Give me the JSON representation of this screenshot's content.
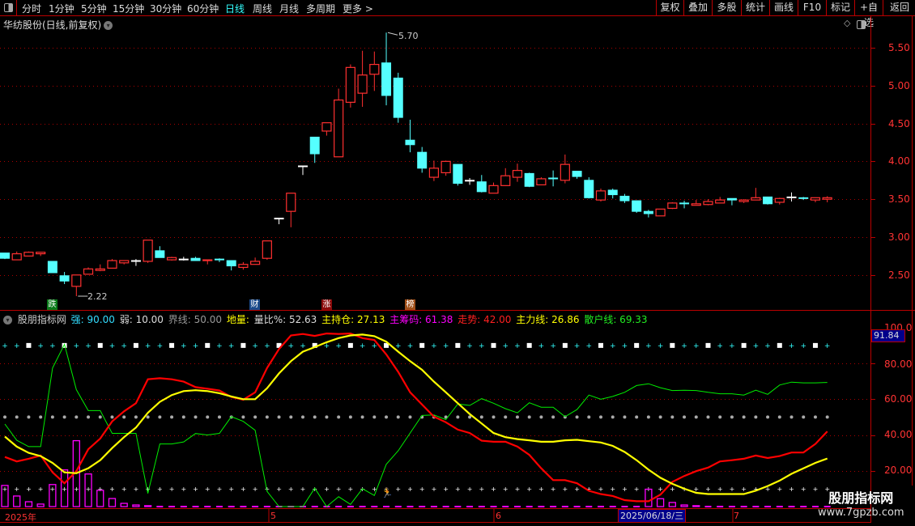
{
  "toolbar": {
    "periods": [
      "分时",
      "1分钟",
      "5分钟",
      "15分钟",
      "30分钟",
      "60分钟",
      "日线",
      "周线",
      "月线",
      "多周期",
      "更多 >"
    ],
    "active_period": "日线",
    "buttons": [
      "复权",
      "叠加",
      "多股",
      "统计",
      "画线",
      "F10",
      "标记",
      "+自选",
      "返回"
    ]
  },
  "stock": {
    "title": "华纺股份(日线,前复权)"
  },
  "price_axis": {
    "ticks": [
      "5.50",
      "5.00",
      "4.50",
      "4.00",
      "3.50",
      "3.00",
      "2.50"
    ]
  },
  "price_annotations": {
    "high": "5.70",
    "low": "2.22"
  },
  "markers": [
    {
      "text": "跌",
      "color": "#0a7a1a"
    },
    {
      "text": "财",
      "color": "#1a4a8a"
    },
    {
      "text": "涨",
      "color": "#8a0a0a"
    },
    {
      "text": "榜",
      "color": "#a0501a"
    }
  ],
  "indicator": {
    "name": "股朋指标网",
    "params": [
      {
        "label": "强: 90.00",
        "color": "#33ddff"
      },
      {
        "label": "弱: 10.00",
        "color": "#dddddd"
      },
      {
        "label": "界线: 50.00",
        "color": "#999999"
      },
      {
        "label": "地量:",
        "color": "#ffff00"
      },
      {
        "label": "量比%: 52.63",
        "color": "#dddddd"
      },
      {
        "label": "主持仓: 27.13",
        "color": "#ffff00"
      },
      {
        "label": "主筹码: 61.38",
        "color": "#ff00ff"
      },
      {
        "label": "走势: 42.00",
        "color": "#ff2020"
      },
      {
        "label": "主力线: 26.86",
        "color": "#ffff00"
      },
      {
        "label": "散户线: 69.33",
        "color": "#22ee22"
      }
    ],
    "axis_ticks": [
      "100.0",
      "80.00",
      "60.00",
      "40.00",
      "20.00"
    ],
    "current_value": "91.84"
  },
  "time_axis": {
    "labels": [
      "2025年",
      "5",
      "6",
      "7"
    ],
    "highlighted_date": "2025/06/18/三"
  },
  "watermark": {
    "name": "股朋指标网",
    "url": "www.7gpzb.com"
  },
  "colors": {
    "up": "#ff3030",
    "down": "#55ffff",
    "flat": "#ffffff",
    "trend": "#ff0000",
    "main": "#ffff00",
    "retail": "#00ee00",
    "chips": "#ff00ff"
  },
  "chart_data": [
    {
      "type": "candlestick",
      "title": "华纺股份(日线,前复权)",
      "ylim": [
        2.1,
        5.75
      ],
      "ohlc_fields": [
        "open",
        "high",
        "low",
        "close"
      ],
      "candles": [
        [
          2.79,
          2.79,
          2.71,
          2.72
        ],
        [
          2.7,
          2.81,
          2.7,
          2.78
        ],
        [
          2.75,
          2.81,
          2.75,
          2.8
        ],
        [
          2.78,
          2.8,
          2.75,
          2.8
        ],
        [
          2.68,
          2.68,
          2.53,
          2.53
        ],
        [
          2.49,
          2.54,
          2.38,
          2.42
        ],
        [
          2.35,
          2.5,
          2.22,
          2.5
        ],
        [
          2.51,
          2.6,
          2.51,
          2.58
        ],
        [
          2.56,
          2.64,
          2.55,
          2.58
        ],
        [
          2.59,
          2.71,
          2.59,
          2.69
        ],
        [
          2.66,
          2.69,
          2.64,
          2.69
        ],
        [
          2.69,
          2.71,
          2.62,
          2.69
        ],
        [
          2.68,
          2.96,
          2.66,
          2.96
        ],
        [
          2.82,
          2.88,
          2.73,
          2.73
        ],
        [
          2.7,
          2.74,
          2.69,
          2.73
        ],
        [
          2.71,
          2.74,
          2.69,
          2.71
        ],
        [
          2.72,
          2.74,
          2.69,
          2.69
        ],
        [
          2.69,
          2.7,
          2.64,
          2.7
        ],
        [
          2.71,
          2.72,
          2.67,
          2.7
        ],
        [
          2.69,
          2.69,
          2.56,
          2.62
        ],
        [
          2.6,
          2.67,
          2.57,
          2.64
        ],
        [
          2.64,
          2.73,
          2.64,
          2.68
        ],
        [
          2.72,
          2.95,
          2.7,
          2.95
        ],
        [
          3.25,
          3.25,
          3.17,
          3.25
        ],
        [
          3.34,
          3.58,
          3.13,
          3.58
        ],
        [
          3.94,
          3.94,
          3.82,
          3.94
        ],
        [
          4.32,
          4.32,
          3.98,
          4.1
        ],
        [
          4.4,
          4.51,
          4.34,
          4.51
        ],
        [
          4.06,
          4.96,
          4.06,
          4.81
        ],
        [
          4.78,
          5.28,
          4.71,
          5.24
        ],
        [
          4.9,
          5.46,
          4.72,
          5.14
        ],
        [
          5.15,
          5.45,
          4.93,
          5.28
        ],
        [
          5.3,
          5.7,
          4.74,
          4.87
        ],
        [
          5.1,
          5.17,
          4.51,
          4.58
        ],
        [
          4.28,
          4.55,
          4.12,
          4.22
        ],
        [
          4.12,
          4.19,
          3.85,
          3.91
        ],
        [
          3.79,
          4.01,
          3.74,
          3.91
        ],
        [
          3.85,
          4.01,
          3.81,
          4.0
        ],
        [
          3.96,
          3.96,
          3.68,
          3.71
        ],
        [
          3.75,
          3.78,
          3.69,
          3.75
        ],
        [
          3.73,
          3.82,
          3.59,
          3.6
        ],
        [
          3.58,
          3.72,
          3.58,
          3.68
        ],
        [
          3.68,
          3.91,
          3.68,
          3.81
        ],
        [
          3.79,
          3.97,
          3.73,
          3.88
        ],
        [
          3.84,
          3.85,
          3.66,
          3.67
        ],
        [
          3.69,
          3.79,
          3.69,
          3.77
        ],
        [
          3.78,
          3.88,
          3.67,
          3.77
        ],
        [
          3.75,
          4.09,
          3.71,
          3.96
        ],
        [
          3.87,
          3.87,
          3.77,
          3.8
        ],
        [
          3.75,
          3.79,
          3.51,
          3.52
        ],
        [
          3.49,
          3.64,
          3.47,
          3.61
        ],
        [
          3.62,
          3.64,
          3.51,
          3.56
        ],
        [
          3.54,
          3.57,
          3.45,
          3.48
        ],
        [
          3.48,
          3.48,
          3.32,
          3.34
        ],
        [
          3.34,
          3.36,
          3.26,
          3.31
        ],
        [
          3.28,
          3.37,
          3.28,
          3.37
        ],
        [
          3.38,
          3.46,
          3.37,
          3.45
        ],
        [
          3.45,
          3.48,
          3.38,
          3.44
        ],
        [
          3.42,
          3.49,
          3.42,
          3.44
        ],
        [
          3.43,
          3.5,
          3.42,
          3.47
        ],
        [
          3.45,
          3.53,
          3.45,
          3.49
        ],
        [
          3.51,
          3.51,
          3.42,
          3.49
        ],
        [
          3.47,
          3.5,
          3.45,
          3.49
        ],
        [
          3.49,
          3.65,
          3.49,
          3.52
        ],
        [
          3.53,
          3.53,
          3.43,
          3.44
        ],
        [
          3.46,
          3.52,
          3.43,
          3.51
        ],
        [
          3.53,
          3.59,
          3.47,
          3.53
        ],
        [
          3.52,
          3.53,
          3.49,
          3.51
        ],
        [
          3.49,
          3.52,
          3.46,
          3.52
        ],
        [
          3.5,
          3.54,
          3.46,
          3.52
        ]
      ]
    },
    {
      "type": "line",
      "title": "股朋指标网",
      "ylim": [
        0,
        100
      ],
      "reference_lines": [
        90,
        50,
        10
      ],
      "series": [
        {
          "name": "走势",
          "values": [
            27.7,
            25.2,
            26.7,
            28.5,
            19.1,
            13.0,
            19.8,
            32.0,
            38.0,
            47.6,
            53.2,
            57.7,
            71.1,
            71.7,
            71.1,
            69.8,
            66.7,
            65.8,
            64.8,
            61.2,
            59.7,
            63.8,
            77.4,
            88.0,
            95.6,
            96.4,
            95.3,
            96.7,
            96.4,
            96.7,
            94.1,
            93.0,
            85.0,
            75.2,
            63.8,
            57.0,
            50.2,
            47.1,
            43.0,
            41.1,
            36.8,
            36.2,
            36.2,
            33.5,
            28.9,
            21.4,
            14.8,
            14.8,
            13.0,
            8.8,
            7.0,
            5.9,
            3.6,
            3.0,
            3.0,
            6.7,
            13.8,
            17.1,
            19.8,
            21.8,
            25.2,
            25.9,
            26.7,
            28.5,
            27.1,
            28.2,
            30.2,
            30.2,
            35.0,
            42.0
          ]
        },
        {
          "name": "主力线",
          "values": [
            39.1,
            33.5,
            30.0,
            28.2,
            24.4,
            19.1,
            18.6,
            21.4,
            25.9,
            32.7,
            38.8,
            44.1,
            52.4,
            58.5,
            62.3,
            64.5,
            65.0,
            64.5,
            63.3,
            61.5,
            60.0,
            60.0,
            66.1,
            74.4,
            81.2,
            86.5,
            89.1,
            91.8,
            94.1,
            95.6,
            96.1,
            95.2,
            92.1,
            86.5,
            81.2,
            76.4,
            69.8,
            63.8,
            57.7,
            51.7,
            46.4,
            41.1,
            38.8,
            37.7,
            37.0,
            36.2,
            36.2,
            37.0,
            37.3,
            36.5,
            35.8,
            33.9,
            30.5,
            25.9,
            20.6,
            16.1,
            12.7,
            10.0,
            7.7,
            7.0,
            7.0,
            7.0,
            7.0,
            8.9,
            11.5,
            14.5,
            18.3,
            21.4,
            24.4,
            26.86
          ]
        },
        {
          "name": "散户线",
          "values": [
            46.1,
            37.0,
            33.5,
            33.5,
            77.4,
            90.6,
            65.3,
            53.6,
            53.6,
            40.9,
            40.9,
            40.9,
            7.3,
            35.0,
            35.0,
            36.1,
            40.8,
            40.0,
            40.9,
            50.2,
            47.6,
            42.6,
            8.5,
            0,
            0,
            0,
            10.3,
            0,
            5.5,
            1.2,
            10.0,
            6.2,
            23.6,
            31.2,
            41.1,
            50.9,
            51.2,
            48.6,
            57.3,
            56.5,
            60.3,
            57.7,
            54.7,
            52.4,
            58.0,
            55.5,
            55.5,
            50.2,
            54.2,
            62.3,
            60.0,
            61.5,
            63.8,
            67.6,
            68.6,
            66.4,
            64.8,
            65.0,
            64.8,
            63.8,
            63.0,
            63.0,
            62.3,
            65.0,
            62.7,
            67.9,
            69.5,
            69.1,
            69.1,
            69.33
          ]
        },
        {
          "name": "主筹码柱",
          "type": "bar",
          "values": [
            11.8,
            5.9,
            2.7,
            1.4,
            12.3,
            20.5,
            36.8,
            18.2,
            9.1,
            4.5,
            1.8,
            0.9,
            0.5,
            0.2,
            0.2,
            0.2,
            0.2,
            0.2,
            0.2,
            0.2,
            0.2,
            0.2,
            0.2,
            0.2,
            0.2,
            0.2,
            0.2,
            0.2,
            0.2,
            0.2,
            0.2,
            0.2,
            0.2,
            0.2,
            0.2,
            0.2,
            0.2,
            0.2,
            0.2,
            0.2,
            0.2,
            0.2,
            0.2,
            0.2,
            0.2,
            0.2,
            0.2,
            0.2,
            0.2,
            0.2,
            0.2,
            0.2,
            0.2,
            0.2,
            9.7,
            4.4,
            2.3,
            0.9,
            0.5,
            0.2,
            0.2,
            0.2,
            0.2,
            0.2,
            0.2,
            0.2,
            0.2,
            0.2,
            0.2,
            0.2
          ]
        }
      ]
    }
  ]
}
